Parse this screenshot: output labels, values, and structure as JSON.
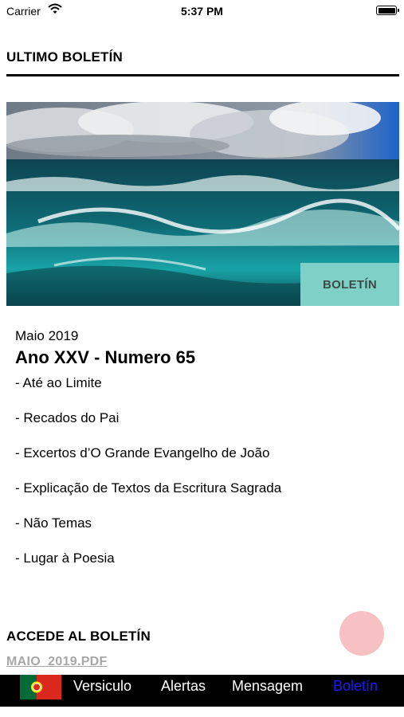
{
  "status_bar": {
    "carrier": "Carrier",
    "time": "5:37 PM"
  },
  "header": {
    "title": "ULTIMO BOLETÍN"
  },
  "hero": {
    "badge": "BOLETÍN"
  },
  "issue": {
    "date": "Maio 2019",
    "title": "Ano XXV - Numero 65",
    "items": [
      "- Até ao Limite",
      "- Recados do Pai",
      "- Excertos d’O Grande Evangelho de João",
      "- Explicação de Textos da Escritura Sagrada",
      "- Não Temas",
      "- Lugar à Poesia"
    ]
  },
  "access": {
    "title": "ACCEDE AL BOLETÍN",
    "pdf_link": "MAIO_2019.PDF"
  },
  "tabbar": {
    "flag_icon": "portugal-flag-icon",
    "tabs": [
      "Versiculo",
      "Alertas",
      "Mensagem",
      "Boletín"
    ],
    "active_tab": "Boletín",
    "active_color": "#1a1aff"
  },
  "fab": {
    "color": "#f6b5b8"
  }
}
